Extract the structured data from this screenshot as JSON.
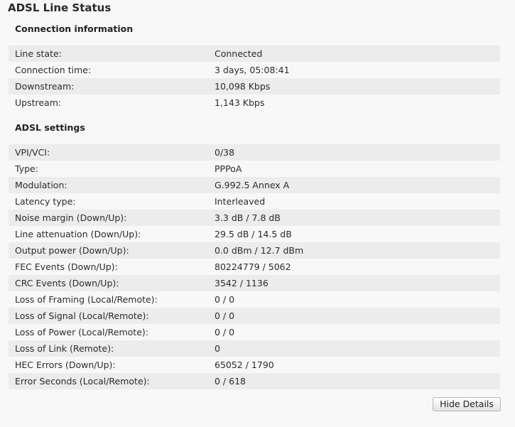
{
  "page": {
    "title": "ADSL Line Status"
  },
  "connection": {
    "title": "Connection information",
    "rows": [
      {
        "label": "Line state:",
        "value": "Connected"
      },
      {
        "label": "Connection time:",
        "value": "3 days, 05:08:41"
      },
      {
        "label": "Downstream:",
        "value": "10,098 Kbps"
      },
      {
        "label": "Upstream:",
        "value": "1,143 Kbps"
      }
    ]
  },
  "adsl": {
    "title": "ADSL settings",
    "rows": [
      {
        "label": "VPI/VCI:",
        "value": "0/38"
      },
      {
        "label": "Type:",
        "value": "PPPoA"
      },
      {
        "label": "Modulation:",
        "value": "G.992.5 Annex A"
      },
      {
        "label": "Latency type:",
        "value": "Interleaved"
      },
      {
        "label": "Noise margin (Down/Up):",
        "value": "3.3 dB / 7.8 dB"
      },
      {
        "label": "Line attenuation (Down/Up):",
        "value": "29.5 dB / 14.5 dB"
      },
      {
        "label": "Output power (Down/Up):",
        "value": "0.0 dBm / 12.7 dBm"
      },
      {
        "label": "FEC Events (Down/Up):",
        "value": "80224779 / 5062"
      },
      {
        "label": "CRC Events (Down/Up):",
        "value": "3542 / 1136"
      },
      {
        "label": "Loss of Framing (Local/Remote):",
        "value": "0 / 0"
      },
      {
        "label": "Loss of Signal (Local/Remote):",
        "value": "0 / 0"
      },
      {
        "label": "Loss of Power (Local/Remote):",
        "value": "0 / 0"
      },
      {
        "label": "Loss of Link (Remote):",
        "value": "0"
      },
      {
        "label": "HEC Errors (Down/Up):",
        "value": "65052 / 1790"
      },
      {
        "label": "Error Seconds (Local/Remote):",
        "value": "0 / 618"
      }
    ]
  },
  "actions": {
    "hide_details_label": "Hide Details"
  }
}
